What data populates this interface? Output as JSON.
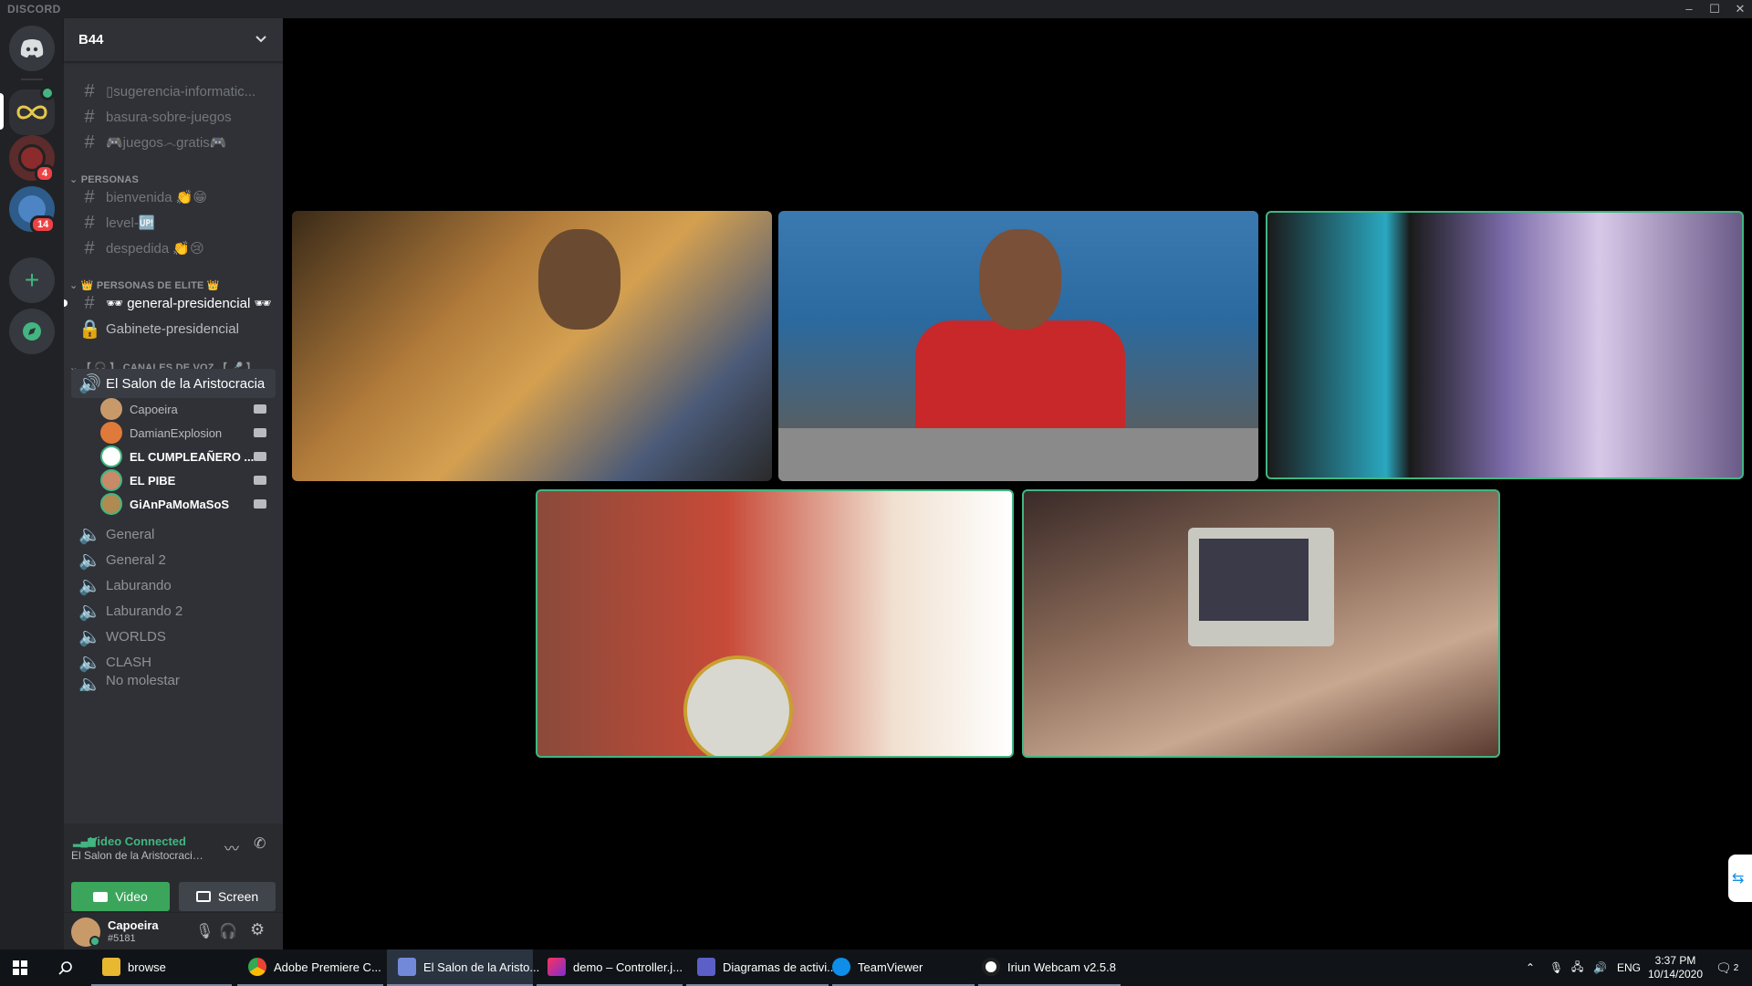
{
  "app": {
    "brand": "DISCORD"
  },
  "window_controls": {
    "minimize": "–",
    "maximize": "☐",
    "close": "✕"
  },
  "servers": {
    "badges": [
      "4",
      "14"
    ]
  },
  "guild": {
    "name": "B44"
  },
  "channels": [
    {
      "name": "▯sugerencia-informatic...",
      "type": "text"
    },
    {
      "name": "basura-sobre-juegos",
      "type": "text"
    },
    {
      "name": "🎮juegos෴gratis🎮",
      "type": "text"
    }
  ],
  "category_personas": {
    "label": "PERSONAS",
    "channels": [
      {
        "name": "bienvenida 👏😁"
      },
      {
        "name": "level-🆙"
      },
      {
        "name": "despedida 👏😢"
      }
    ]
  },
  "category_elite": {
    "label": "👑 PERSONAS DE ELITE 👑",
    "channels": [
      {
        "name": "🕶 general-presidencial 🕶"
      },
      {
        "name": "Gabinete-presidencial"
      }
    ]
  },
  "category_voice": {
    "label": "【 🎧 】 CANALES DE VOZ 【 🎤 】",
    "active_channel": "El Salon de la Aristocracia",
    "members": [
      "Capoeira",
      "DamianExplosion",
      "EL CUMPLEAÑERO ...",
      "EL PIBE",
      "GiAnPaMoMaSoS"
    ],
    "channels": [
      "General",
      "General 2",
      "Laburando",
      "Laburando 2",
      "WORLDS",
      "CLASH",
      "No molestar"
    ]
  },
  "voice_panel": {
    "status": "Video Connected",
    "subtitle": "El Salon de la Aristocracia /...",
    "video_label": "Video",
    "screen_label": "Screen"
  },
  "user": {
    "name": "Capoeira",
    "tag": "#5181"
  },
  "taskbar": {
    "apps": [
      {
        "label": "browse"
      },
      {
        "label": "Adobe Premiere C..."
      },
      {
        "label": "El Salon de la Aristo..."
      },
      {
        "label": "demo – Controller.j..."
      },
      {
        "label": "Diagramas de activi..."
      },
      {
        "label": "TeamViewer"
      },
      {
        "label": "Iriun Webcam v2.5.8"
      }
    ],
    "lang": "ENG",
    "time": "3:37 PM",
    "date": "10/14/2020",
    "notifications": "2"
  },
  "colors": {
    "accent_green": "#43b581",
    "sidebar": "#2f3136",
    "rail": "#202225",
    "blurple": "#7289da",
    "danger": "#ed4245"
  }
}
